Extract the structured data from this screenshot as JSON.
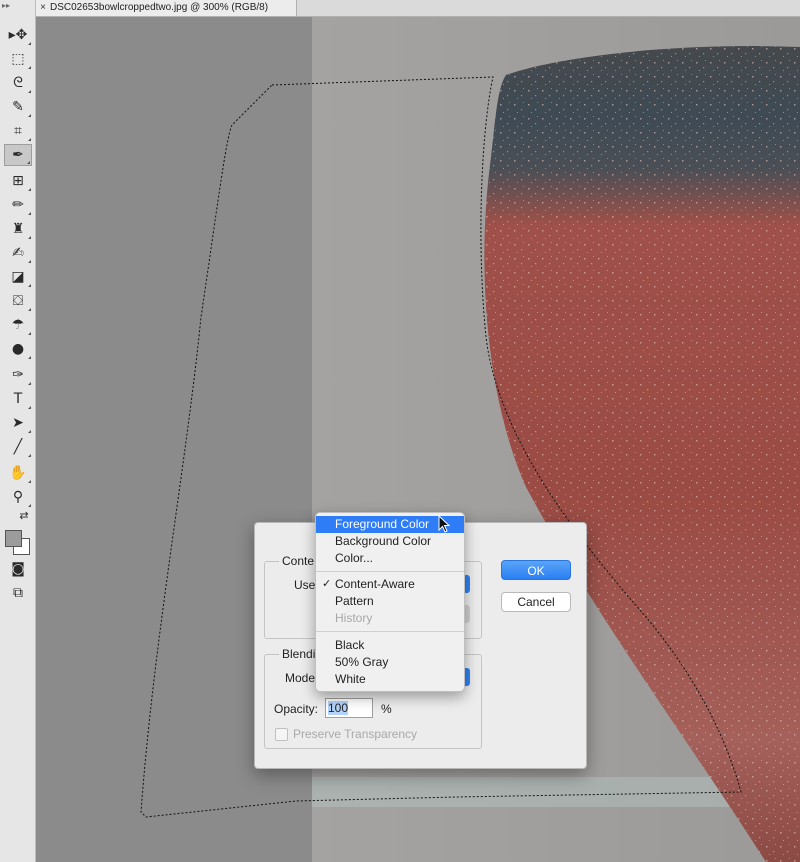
{
  "toolbar": {
    "tools": [
      {
        "name": "move-tool-icon",
        "glyph": "▸✥"
      },
      {
        "name": "marquee-tool-icon",
        "glyph": "⬚"
      },
      {
        "name": "lasso-tool-icon",
        "glyph": "ᘓ"
      },
      {
        "name": "quick-selection-tool-icon",
        "glyph": "✎"
      },
      {
        "name": "crop-tool-icon",
        "glyph": "⌗"
      },
      {
        "name": "eyedropper-tool-icon",
        "glyph": "✒"
      },
      {
        "name": "healing-brush-tool-icon",
        "glyph": "⊞"
      },
      {
        "name": "brush-tool-icon",
        "glyph": "✏"
      },
      {
        "name": "clone-stamp-tool-icon",
        "glyph": "♜"
      },
      {
        "name": "history-brush-tool-icon",
        "glyph": "✍"
      },
      {
        "name": "eraser-tool-icon",
        "glyph": "◪"
      },
      {
        "name": "paint-bucket-tool-icon",
        "glyph": "⛋"
      },
      {
        "name": "blur-tool-icon",
        "glyph": "☂"
      },
      {
        "name": "dodge-tool-icon",
        "glyph": "●"
      },
      {
        "name": "pen-tool-icon",
        "glyph": "✑"
      },
      {
        "name": "type-tool-icon",
        "glyph": "T"
      },
      {
        "name": "path-selection-tool-icon",
        "glyph": "➤"
      },
      {
        "name": "line-tool-icon",
        "glyph": "╱"
      },
      {
        "name": "hand-tool-icon",
        "glyph": "✋"
      },
      {
        "name": "zoom-tool-icon",
        "glyph": "⚲"
      },
      {
        "name": "swap-colors-icon",
        "glyph": "⇄"
      },
      {
        "name": "color-swatches",
        "glyph": ""
      },
      {
        "name": "quick-mask-icon",
        "glyph": "◙"
      },
      {
        "name": "screen-mode-icon",
        "glyph": "⧉"
      }
    ],
    "active_index": 5,
    "foreground_color": "#9c9c9c",
    "background_color": "#ffffff"
  },
  "document": {
    "tab_title": "DSC02653bowlcroppedtwo.jpg @ 300% (RGB/8)",
    "close_glyph": "×"
  },
  "colors": {
    "bowl_red": "#9e4d45",
    "bowl_dark": "#3d4247",
    "bowl_blue": "#5d7f9a",
    "wall": "#a3a19f",
    "left_area": "#8b8b8b",
    "accent": "#2e7cf6"
  },
  "dialog": {
    "contents_group_title": "Conte",
    "use_label": "Use",
    "blending_group_title": "Blendi",
    "mode_label": "Mode",
    "opacity_label": "Opacity:",
    "opacity_value": "100",
    "opacity_unit": "%",
    "preserve_transparency_label": "Preserve Transparency",
    "ok_label": "OK",
    "cancel_label": "Cancel"
  },
  "menu": {
    "items": [
      {
        "label": "Foreground Color",
        "state": "highlighted"
      },
      {
        "label": "Background Color",
        "state": "normal"
      },
      {
        "label": "Color...",
        "state": "normal"
      },
      {
        "label": "Content-Aware",
        "state": "checked"
      },
      {
        "label": "Pattern",
        "state": "normal"
      },
      {
        "label": "History",
        "state": "disabled"
      },
      {
        "label": "Black",
        "state": "normal"
      },
      {
        "label": "50% Gray",
        "state": "normal"
      },
      {
        "label": "White",
        "state": "normal"
      }
    ],
    "check_glyph": "✓"
  }
}
